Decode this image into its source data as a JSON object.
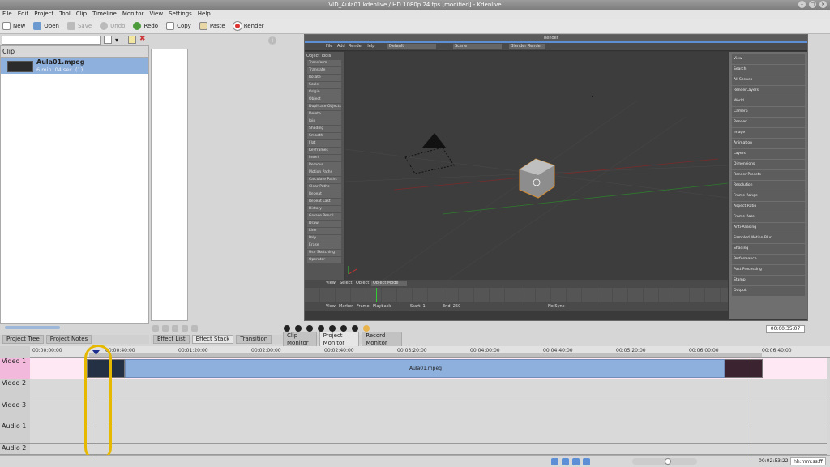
{
  "window": {
    "title": "VID_Aula01.kdenlive / HD 1080p 24 fps [modified] - Kdenlive"
  },
  "menu": [
    "File",
    "Edit",
    "Project",
    "Tool",
    "Clip",
    "Timeline",
    "Monitor",
    "View",
    "Settings",
    "Help"
  ],
  "toolbar": {
    "new": "New",
    "open": "Open",
    "save": "Save",
    "undo": "Undo",
    "redo": "Redo",
    "copy": "Copy",
    "paste": "Paste",
    "render": "Render"
  },
  "clip_panel": {
    "header": "Clip",
    "clip_name": "Aula01.mpeg",
    "clip_meta": "6 min. 04 sec. (1)"
  },
  "left_tabs": {
    "project_tree": "Project Tree",
    "project_notes": "Project Notes"
  },
  "effect_tabs": {
    "effect_list": "Effect List",
    "effect_stack": "Effect Stack",
    "transition": "Transition"
  },
  "monitor_tabs": {
    "clip_monitor": "Clip Monitor",
    "project_monitor": "Project Monitor",
    "record_monitor": "Record Monitor"
  },
  "monitor_timecode": "00:00:35:07",
  "timeline": {
    "ruler_labels": [
      "00:00:00:00",
      "00:00:40:00",
      "00:01:20:00",
      "00:02:00:00",
      "00:02:40:00",
      "00:03:20:00",
      "00:04:00:00",
      "00:04:40:00",
      "00:05:20:00",
      "00:06:00:00",
      "00:06:40:00"
    ],
    "tracks": [
      "Video 1",
      "Video 2",
      "Video 3",
      "Audio 1",
      "Audio 2"
    ],
    "clip_label": "Aula01.mpeg"
  },
  "status": {
    "timecode": "00:02:53:22",
    "format": "hh:mm:ss:ff"
  },
  "blender": {
    "header_label": "Render",
    "menu": [
      "File",
      "Add",
      "Render",
      "Help"
    ],
    "layout": "Default",
    "scene": "Scene",
    "engine": "Blender Render",
    "tools_title": "Object Tools",
    "tools": [
      "Transform",
      "Translate",
      "Rotate",
      "Scale",
      "Origin",
      "Object",
      "Duplicate Objects",
      "Delete",
      "Join",
      "Shading",
      "Smooth",
      "Flat",
      "Keyframes",
      "Insert",
      "Remove",
      "Motion Paths",
      "Calculate Paths",
      "Clear Paths",
      "Repeat",
      "Repeat Last",
      "History",
      "Grease Pencil",
      "Draw",
      "Line",
      "Poly",
      "Erase",
      "Use Sketching",
      "Operator"
    ],
    "vp_bar_items": [
      "View",
      "Select",
      "Object",
      "Object Mode"
    ],
    "props_items": [
      "View",
      "Search",
      "All Scenes",
      "RenderLayers",
      "World",
      "Camera",
      "Render",
      "Image",
      "Animation",
      "Layers",
      "Dimensions",
      "Render Presets",
      "Resolution",
      "Frame Range",
      "Aspect Ratio",
      "Frame Rate",
      "Anti-Aliasing",
      "Sampled Motion Blur",
      "Shading",
      "Performance",
      "Post Processing",
      "Stamp",
      "Output"
    ],
    "timeline_items": [
      "View",
      "Marker",
      "Frame",
      "Playback",
      "Start: 1",
      "End: 250",
      "No Sync"
    ]
  }
}
